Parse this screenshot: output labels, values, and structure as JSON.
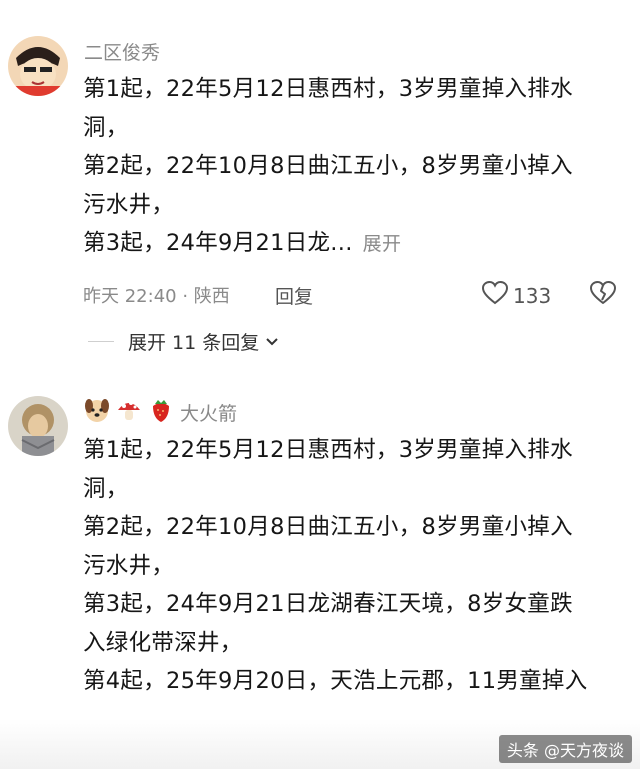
{
  "comments": [
    {
      "username": "二区俊秀",
      "lines": [
        "第1起，22年5月12日惠西村，3岁男童掉入排水",
        "洞，",
        "第2起，22年10月8日曲江五小，8岁男童小掉入",
        "污水井，",
        "第3起，24年9月21日龙..."
      ],
      "expand_inline": "展开",
      "time_location": "昨天 22:40 · 陕西",
      "reply_label": "回复",
      "like_count": "133",
      "expand_replies": "展开 11 条回复"
    },
    {
      "username": "大火箭",
      "badges": [
        "dog-emoji",
        "mushroom-emoji",
        "strawberry-emoji"
      ],
      "lines": [
        "第1起，22年5月12日惠西村，3岁男童掉入排水",
        "洞，",
        "第2起，22年10月8日曲江五小，8岁男童小掉入",
        "污水井，",
        "第3起，24年9月21日龙湖春江天境，8岁女童跌",
        "入绿化带深井，",
        "第4起，25年9月20日，天浩上元郡，11男童掉入"
      ]
    }
  ],
  "watermark": "头条 @天方夜谈"
}
